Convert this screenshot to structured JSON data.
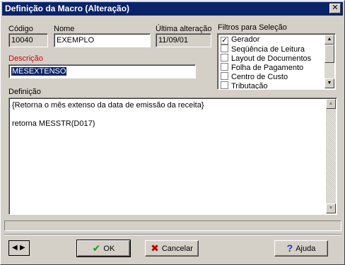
{
  "window": {
    "title": "Definição da Macro (Alteração)",
    "close_symbol": "✕"
  },
  "codigo": {
    "label": "Código",
    "value": "10040"
  },
  "nome": {
    "label": "Nome",
    "value": "EXEMPLO"
  },
  "ultima_alteracao": {
    "label": "Última alteração",
    "value": "11/09/01"
  },
  "descricao": {
    "label": "Descrição",
    "value": "MESEXTENSO"
  },
  "filtros": {
    "label": "Filtros para Seleção",
    "items": [
      {
        "label": "Gerador",
        "checked": true
      },
      {
        "label": "Seqüência de Leitura",
        "checked": false
      },
      {
        "label": "Layout de Documentos",
        "checked": false
      },
      {
        "label": "Folha de Pagamento",
        "checked": false
      },
      {
        "label": "Centro de Custo",
        "checked": false
      },
      {
        "label": "Tributação",
        "checked": false
      }
    ]
  },
  "definicao": {
    "label": "Definição",
    "lines": [
      "{Retorna o mês extenso da data de emissão da receita}",
      "",
      "retorna MESSTR(D017)"
    ]
  },
  "buttons": {
    "ok": "OK",
    "cancelar": "Cancelar",
    "ajuda": "Ajuda"
  },
  "colors": {
    "titlebar": "#0a246a",
    "face": "#d4d0c8",
    "label_red": "#d00000",
    "ok_icon": "#1a9a1a",
    "cancel_icon": "#c00000",
    "help_icon": "#1a3acc"
  },
  "icons": {
    "ok": "check-icon",
    "cancel": "x-icon",
    "help": "question-icon",
    "nav": "left-right-arrows-icon"
  }
}
